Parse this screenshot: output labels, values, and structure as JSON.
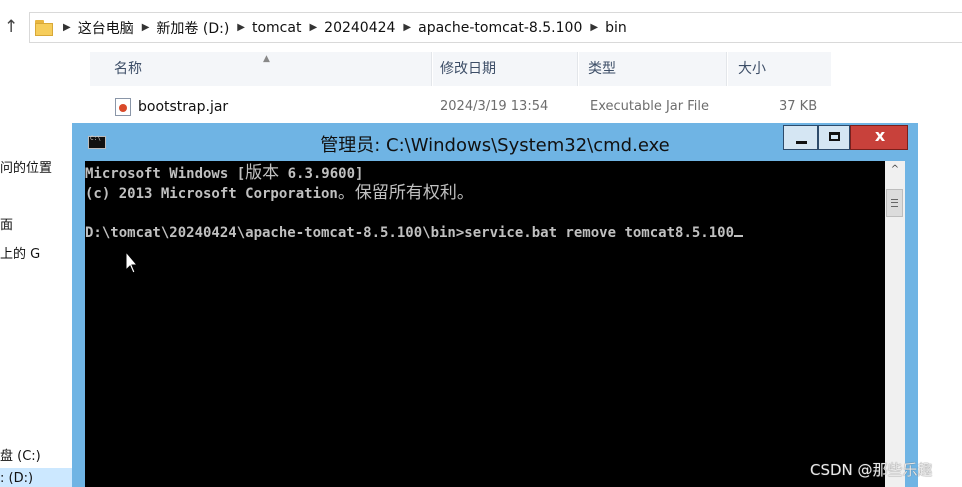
{
  "explorer": {
    "breadcrumb": [
      "这台电脑",
      "新加卷 (D:)",
      "tomcat",
      "20240424",
      "apache-tomcat-8.5.100",
      "bin"
    ],
    "columns": {
      "name": "名称",
      "date": "修改日期",
      "type": "类型",
      "size": "大小"
    },
    "files": [
      {
        "name": "bootstrap.jar",
        "date": "2024/3/19 13:54",
        "type": "Executable Jar File",
        "size": "37 KB"
      }
    ],
    "nav_fragments": [
      "问的位置",
      "面",
      "上的 G",
      "盘 (C:)",
      ": (D:)"
    ]
  },
  "cmd": {
    "title": "管理员: C:\\Windows\\System32\\cmd.exe",
    "line1_ascii": "Microsoft Windows [",
    "line1_cjk": "版本",
    "line1_ascii2": " 6.3.9600]",
    "line2_ascii": "(c) 2013 Microsoft Corporation",
    "line2_cjk": "。保留所有权利。",
    "line3": "D:\\tomcat\\20240424\\apache-tomcat-8.5.100\\bin>service.bat remove tomcat8.5.100"
  },
  "watermark": "CSDN @那些乐趣",
  "icons": {
    "up": "up-arrow-icon",
    "folder": "folder-icon",
    "jar": "jar-file-icon",
    "cmd": "cmd-icon",
    "minimize": "minimize-icon",
    "maximize": "maximize-icon",
    "close": "close-icon"
  }
}
